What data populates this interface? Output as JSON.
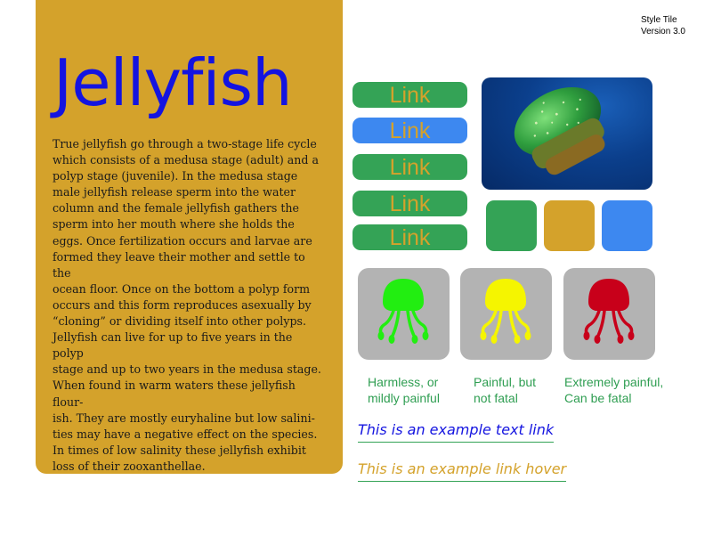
{
  "header": {
    "title": "Jellyfish",
    "style_tile_line1": "Style Tile",
    "style_tile_line2": "Version 3.0"
  },
  "body_text": "True jellyfish go through a two-stage life cycle\nwhich consists of a medusa stage (adult) and a\npolyp stage (juvenile). In the medusa stage\nmale jellyfish release sperm into the water\ncolumn and the female jellyfish gathers the\nsperm into her mouth where she holds the\neggs. Once fertilization occurs and larvae are\nformed they leave their mother and settle to the\nocean floor. Once on the bottom a polyp form\noccurs and this form reproduces asexually by\n“cloning” or dividing itself into other polyps.\nJellyfish can live for up to five years in the polyp\nstage and up to two years in the medusa stage.\nWhen found in warm waters these jellyfish flour-\nish. They are mostly euryhaline but low salini-\nties may have a negative effect on the species.\nIn times of low salinity these jellyfish exhibit\nloss of their zooxanthellae.",
  "links": [
    {
      "label": "Link",
      "color": "#34a356"
    },
    {
      "label": "Link",
      "color": "#3d88f0"
    },
    {
      "label": "Link",
      "color": "#34a356"
    },
    {
      "label": "Link",
      "color": "#34a356"
    },
    {
      "label": "Link",
      "color": "#34a356"
    }
  ],
  "swatches": [
    "#34a356",
    "#d4a22b",
    "#3d88f0"
  ],
  "pain_levels": [
    {
      "caption": "Harmless, or\nmildly painful",
      "color": "#22ee11",
      "icon": "jellyfish-icon"
    },
    {
      "caption": "Painful, but\nnot fatal",
      "color": "#f5f500",
      "icon": "jellyfish-icon"
    },
    {
      "caption": "Extremely painful,\nCan be fatal",
      "color": "#c8001a",
      "icon": "jellyfish-icon"
    }
  ],
  "text_links": {
    "example": "This is an example text link",
    "hover": "This is an example link hover"
  },
  "colors": {
    "panel": "#d4a22b",
    "title": "#1414e0",
    "link_text": "#1414e0",
    "link_hover": "#d4a22b",
    "caption": "#2f9e52"
  }
}
